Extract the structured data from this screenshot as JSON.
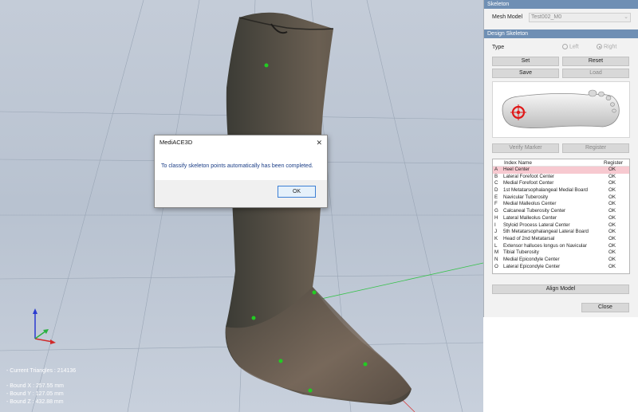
{
  "viewport": {
    "stats": {
      "triangles": "- Current Triangles : 214136",
      "bound_x": "- Bound X : 257.55 mm",
      "bound_y": "- Bound Y : 127.05 mm",
      "bound_z": "- Bound Z : 432.88 mm"
    },
    "brand": {
      "prefix": "Medi",
      "accent": "ACE",
      "suffix": "3D"
    }
  },
  "dialog": {
    "title": "MediACE3D",
    "message": "To classify skeleton points automatically has been completed.",
    "ok_label": "OK",
    "close_glyph": "✕"
  },
  "panel": {
    "skeleton_header": "Skeleton",
    "mesh_model_label": "Mesh Model",
    "mesh_model_value": "Test002_M0",
    "design_header": "Design Skeleton",
    "type_label": "Type",
    "left_label": "Left",
    "right_label": "Right",
    "set_label": "Set",
    "reset_label": "Reset",
    "save_label": "Save",
    "load_label": "Load",
    "verify_label": "Verify Marker",
    "register_label": "Register",
    "align_label": "Align Model",
    "close_label": "Close"
  },
  "table": {
    "col_name": "Index Name",
    "col_register": "Register",
    "rows": [
      {
        "idx": "A",
        "name": "Heel Center",
        "reg": "OK"
      },
      {
        "idx": "B",
        "name": "Lateral Forefoot Center",
        "reg": "OK"
      },
      {
        "idx": "C",
        "name": "Medial Forefoot Center",
        "reg": "OK"
      },
      {
        "idx": "D",
        "name": "1st Metatarsophalangeal Medial Board",
        "reg": "OK"
      },
      {
        "idx": "E",
        "name": "Navicular Tuberosity",
        "reg": "OK"
      },
      {
        "idx": "F",
        "name": "Medial Malleolus Center",
        "reg": "OK"
      },
      {
        "idx": "G",
        "name": "Calcaneal Tuberosity Center",
        "reg": "OK"
      },
      {
        "idx": "H",
        "name": "Lateral Malleolus Center",
        "reg": "OK"
      },
      {
        "idx": "I",
        "name": "Styloid Process Lateral Center",
        "reg": "OK"
      },
      {
        "idx": "J",
        "name": "5th Metatarsophalangeal Lateral Board",
        "reg": "OK"
      },
      {
        "idx": "K",
        "name": "Head of 2nd Metatarsal",
        "reg": "OK"
      },
      {
        "idx": "L",
        "name": "Extensor halluces longus on Navicular",
        "reg": "OK"
      },
      {
        "idx": "M",
        "name": "Tibial Tuberosity",
        "reg": "OK"
      },
      {
        "idx": "N",
        "name": "Medial Epicondyle Center",
        "reg": "OK"
      },
      {
        "idx": "O",
        "name": "Lateral Epicondyle Center",
        "reg": "OK"
      }
    ]
  },
  "colors": {
    "panel_header": "#6f8fb4",
    "selected_row": "#f7c9d0",
    "marker": "#22cc22",
    "heel_target": "#e01818"
  }
}
